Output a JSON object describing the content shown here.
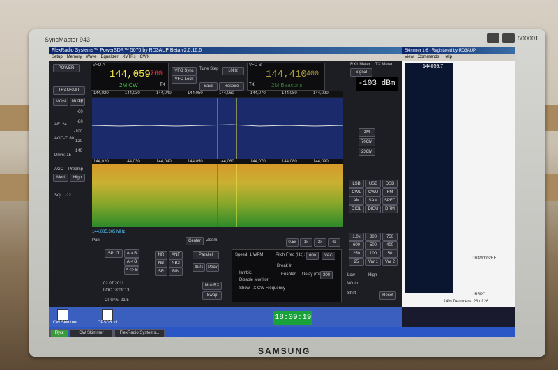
{
  "monitor": {
    "model": "SyncMaster 943",
    "brand": "SAMSUNG",
    "serial": "500001"
  },
  "app": {
    "title": "FlexRadio Systems™ PowerSDR™ 5070 by RD3AUP Beta v2.0.16.6",
    "menu": [
      "Setup",
      "Memory",
      "Wave",
      "Equalizer",
      "XVTRs",
      "CWX"
    ],
    "power_label": "POWER",
    "transmit_label": "TRANSMIT",
    "mon_label": "MON",
    "mute_label": "MUTE",
    "af_label": "AF: 24",
    "agc_label": "AGC-T: 80",
    "drive_label": "Drive: 15",
    "agc2_label": "AGC",
    "preamp_label": "Preamp",
    "agc_value": "Med",
    "preamp_value": "High",
    "sql_label": "SQL: -12",
    "vfoa_label": "VFO A",
    "vfoa_freq": "144,059",
    "vfoa_sub": "760",
    "vfoa_mode": "2M CW",
    "vfo_sync": "VFO Sync",
    "vfo_lock": "VFO Lock",
    "tune_step_label": "Tune Step",
    "tune_step": "10Hz",
    "save_btn": "Save",
    "restore_btn": "Restore",
    "vfob_label": "VFO B",
    "vfob_freq": "144,410",
    "vfob_sub": "400",
    "vfob_mode": "2M Beacons",
    "tx_label": "TX",
    "signal_value": "-103 dBm",
    "rx_meter": "RX1 Meter",
    "tx_meter": "TX Meter",
    "signal_mode": "Signal",
    "band_buttons": [
      "2M",
      "70CM",
      "23CM"
    ],
    "mode_buttons": [
      "LSB",
      "USB",
      "DSB",
      "CWL",
      "CWU",
      "FM",
      "AM",
      "SAM",
      "SPEC",
      "DIGL",
      "DIGU",
      "DRM"
    ],
    "filter_buttons": [
      "1.0k",
      "800",
      "750",
      "600",
      "500",
      "400",
      "250",
      "100",
      "50",
      "25",
      "Var 1",
      "Var 2"
    ],
    "low_label": "Low",
    "high_label": "High",
    "width_label": "Width",
    "shift_label": "Shift",
    "reset_label": "Reset",
    "scale_ticks": [
      "144,020",
      "144,030",
      "144,040",
      "144,050",
      "144,060",
      "144,070",
      "144,080",
      "144,090"
    ],
    "db_ticks": [
      "-40",
      "-60",
      "-80",
      "-100",
      "-120",
      "-140"
    ],
    "pan_label": "Pan:",
    "center_label": "Center",
    "zoom_label": "Zoom:",
    "zoom_btns": [
      "0.5x",
      "1x",
      "2x",
      "4x"
    ],
    "cursor_readout": "144,085.305 MHz",
    "split_btn": "SPLIT",
    "ab_btns": [
      "A > B",
      "A < B",
      "A <> B"
    ],
    "nr_btns": [
      "NR",
      "ANF",
      "NB",
      "NB2",
      "SR",
      "BIN"
    ],
    "panel_select": "Parallel",
    "avg_btn": "AVG",
    "peak_btn": "Peak",
    "date": "02.07.2011",
    "loc_time": "LOC 18:09:13",
    "cpu": "CPU %: 21,5",
    "speed_label": "Speed: 1 WPM",
    "pitch_label": "Pitch Freq (Hz):",
    "pitch_value": "600",
    "vac_label": "VAC",
    "iambic_label": "Iambic",
    "disable_monitor": "Disable Monitor",
    "show_tx_cw": "Show TX CW Frequency",
    "break_in_label": "Break In",
    "enabled_label": "Enabled",
    "delay_label": "Delay (ms):",
    "delay_value": "300",
    "multirx": "MultiRX",
    "swap": "Swap"
  },
  "side_app": {
    "title": "Skimmer 1.6 - Registered by RD3AUP",
    "menu": [
      "View",
      "Commands",
      "Help"
    ],
    "freq": "144059.7",
    "labels": [
      "DR4WDS/EE",
      "UR5PC"
    ],
    "status": "14% Decoders: 26 of 26"
  },
  "desktop": {
    "clock": "18:09:19",
    "icons": [
      "CW Skimmer",
      "CPSDR v1..."
    ]
  },
  "taskbar": {
    "start": "Пуск",
    "tasks": [
      "CW Skimmer",
      "FlexRadio Systems...",
      "CW Skimmer"
    ]
  },
  "colors": {
    "accent_yellow": "#f2e24a",
    "panadapter_bg": "#1a2a6a",
    "waterfall_hot": "#d69a2a",
    "clock_bg": "#19a23a"
  }
}
